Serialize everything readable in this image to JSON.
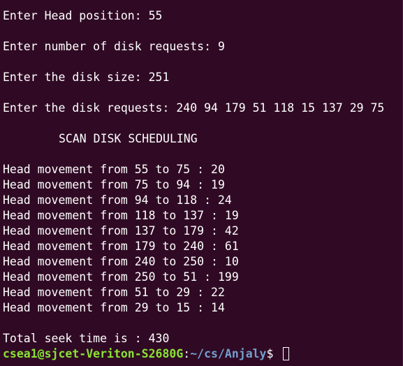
{
  "terminal": {
    "input_lines": [
      "Enter Head position: 55",
      "Enter number of disk requests: 9",
      "Enter the disk size: 251",
      "Enter the disk requests: 240 94 179 51 118 15 137 29 75"
    ],
    "heading": "SCAN DISK SCHEDULING",
    "movements": [
      "Head movement from 55 to 75 : 20",
      "Head movement from 75 to 94 : 19",
      "Head movement from 94 to 118 : 24",
      "Head movement from 118 to 137 : 19",
      "Head movement from 137 to 179 : 42",
      "Head movement from 179 to 240 : 61",
      "Head movement from 240 to 250 : 10",
      "Head movement from 250 to 51 : 199",
      "Head movement from 51 to 29 : 22",
      "Head movement from 29 to 15 : 14"
    ],
    "total": "Total seek time is : 430",
    "prompt": {
      "user_host": "csea1@sjcet-Veriton-S2680G",
      "separator": ":",
      "path": "~/cs/Anjaly",
      "symbol": "$ "
    }
  },
  "colors": {
    "background": "#300a24",
    "text": "#ffffff",
    "user_host": "#8ae234",
    "path": "#729fcf"
  }
}
